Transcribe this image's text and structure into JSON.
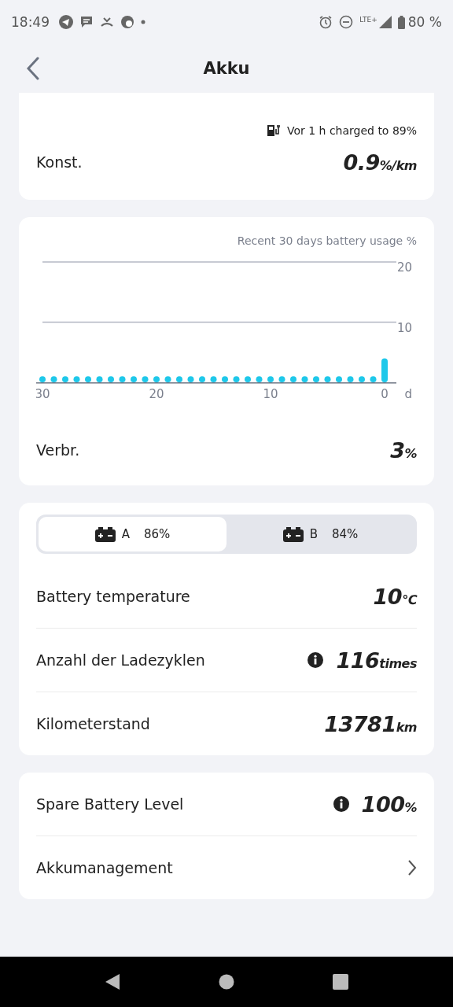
{
  "status_bar": {
    "time": "18:49",
    "network": "LTE+",
    "battery": "80 %"
  },
  "header": {
    "title": "Akku"
  },
  "consumption_card": {
    "charge_note": "Vor 1 h charged to 89%",
    "label": "Konst.",
    "value": "0.9",
    "unit": "%/km"
  },
  "usage_card": {
    "chart_data": {
      "type": "bar",
      "title": "Recent 30 days battery usage %",
      "xlabel": "d",
      "x": [
        30,
        29,
        28,
        27,
        26,
        25,
        24,
        23,
        22,
        21,
        20,
        19,
        18,
        17,
        16,
        15,
        14,
        13,
        12,
        11,
        10,
        9,
        8,
        7,
        6,
        5,
        4,
        3,
        2,
        1,
        0
      ],
      "series": [
        {
          "color": "#1ec8ea",
          "values": [
            1,
            1,
            1,
            1,
            1,
            1,
            1,
            1,
            1,
            1,
            1,
            1,
            1,
            1,
            1,
            1,
            1,
            1,
            1,
            1,
            1,
            1,
            1,
            1,
            1,
            1,
            1,
            1,
            1,
            1,
            4
          ]
        }
      ],
      "xlim": [
        30,
        0
      ],
      "ylim": [
        0,
        20
      ],
      "xticks": [
        30,
        20,
        10,
        0
      ],
      "yticks": [
        10,
        20
      ]
    },
    "label": "Verbr.",
    "value": "3",
    "unit": "%"
  },
  "battery_tabs": [
    {
      "letter": "A",
      "percent": "86%",
      "selected": true
    },
    {
      "letter": "B",
      "percent": "84%",
      "selected": false
    }
  ],
  "battery_rows": [
    {
      "label": "Battery temperature",
      "value": "10",
      "unit": "℃",
      "info": false
    },
    {
      "label": "Anzahl der Ladezyklen",
      "value": "116",
      "unit": "times",
      "info": true
    },
    {
      "label": "Kilometerstand",
      "value": "13781",
      "unit": "km",
      "info": false
    }
  ],
  "spare_rows": [
    {
      "kind": "value",
      "label": "Spare Battery Level",
      "value": "100",
      "unit": "%",
      "info": true
    },
    {
      "kind": "link",
      "label": "Akkumanagement"
    }
  ]
}
